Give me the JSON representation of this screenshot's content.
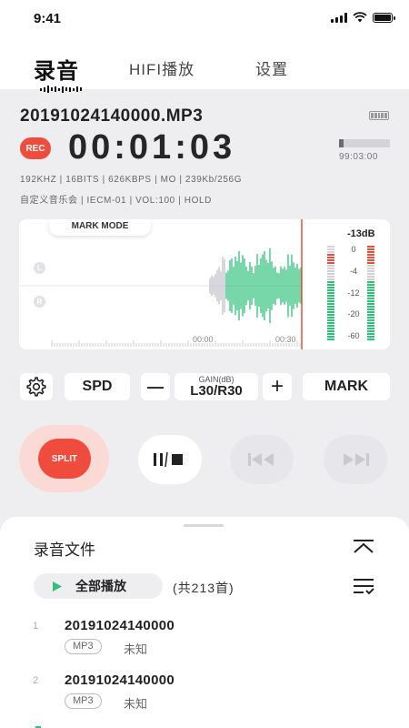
{
  "status_bar": {
    "time": "9:41"
  },
  "tabs": [
    {
      "label": "录音",
      "active": true
    },
    {
      "label": "HIFI播放",
      "active": false
    },
    {
      "label": "设置",
      "active": false
    }
  ],
  "recording": {
    "filename": "20191024140000.MP3",
    "rec_label": "REC",
    "elapsed": "00:01:03",
    "remaining": "99:03:00",
    "remaining_fraction": 0.09,
    "specs_line1": "192KHZ | 16BITS | 626KBPS | MO | 239Kb/256G",
    "specs_line2": "自定义音乐会 | IECM-01 | VOL:100 | HOLD"
  },
  "waveform": {
    "mode_label": "MARK MODE",
    "left_channel": "L",
    "right_channel": "R",
    "timeline_ticks": [
      "00:00",
      "00:30"
    ],
    "level": "-13dB",
    "meter_scale": [
      "0",
      "-4",
      "-12",
      "-20",
      "-60"
    ],
    "accent_color": "#2ec17a",
    "peak_color": "#e2503f"
  },
  "controls": {
    "settings_icon": "gear-icon",
    "speed_label": "SPD",
    "gain_title": "GAIN(dB)",
    "gain_value": "L30/R30",
    "minus_label": "—",
    "plus_label": "+",
    "mark_label": "MARK"
  },
  "transport": {
    "split_label": "SPLIT",
    "play_pause_icon": "play-pause-stop-icon",
    "prev_icon": "skip-previous-icon",
    "next_icon": "skip-next-icon"
  },
  "files": {
    "title": "录音文件",
    "play_all_label": "全部播放",
    "count_text": "(共213首)",
    "items": [
      {
        "index": "1",
        "name": "20191024140000",
        "format": "MP3",
        "meta": "未知"
      },
      {
        "index": "2",
        "name": "20191024140000",
        "format": "MP3",
        "meta": "未知"
      }
    ]
  }
}
